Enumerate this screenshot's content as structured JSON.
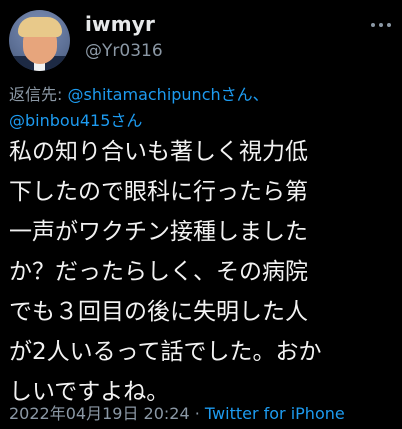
{
  "tweet": {
    "author": {
      "display_name": "iwmyr",
      "handle": "@Yr0316"
    },
    "reply_to": {
      "prefix": "返信先: ",
      "mention_1": "@shitamachipunch",
      "suffix_1": "さん、",
      "mention_2": "@binbou415",
      "suffix_2": "さん"
    },
    "body_lines": [
      "私の知り合いも著しく視力低",
      "下したので眼科に行ったら第",
      "一声がワクチン接種しました",
      "か？だったらしく、その病院",
      "でも３回目の後に失明した人",
      "が2人いるって話でした。おか",
      "しいですよね。"
    ],
    "timestamp": "2022年04月19日 20:24",
    "separator": " · ",
    "source": "Twitter for iPhone"
  },
  "icons": {
    "more": "more-horizontal-icon",
    "avatar": "profile-photo"
  },
  "colors": {
    "background": "#000000",
    "text": "#e7e9ea",
    "secondary": "#8b98a5",
    "accent": "#1d9bf0"
  }
}
